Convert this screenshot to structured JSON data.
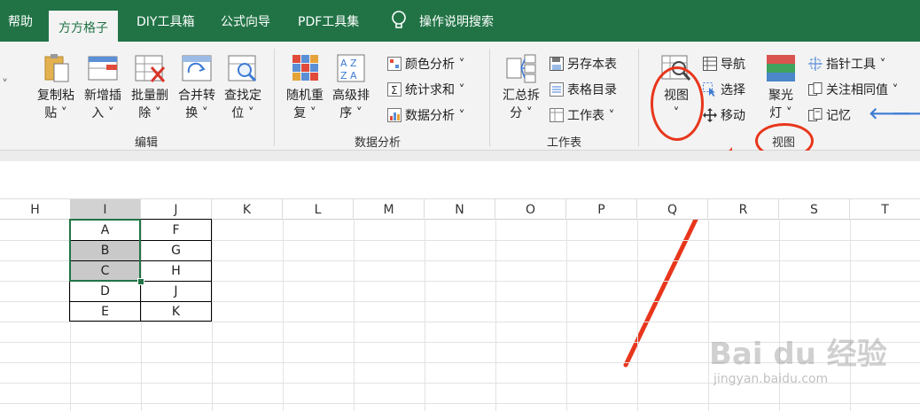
{
  "tabs": [
    "帮助",
    "方方格子",
    "DIY工具箱",
    "公式向导",
    "PDF工具集",
    "操作说明搜索"
  ],
  "active_tab": "方方格子",
  "groups": {
    "edit": {
      "label": "编辑",
      "buttons": [
        {
          "line1": "复制粘",
          "line2": "贴 ˅",
          "icon": "paste-icon"
        },
        {
          "line1": "新增插",
          "line2": "入 ˅",
          "icon": "insert-icon"
        },
        {
          "line1": "批量删",
          "line2": "除 ˅",
          "icon": "delete-icon"
        },
        {
          "line1": "合并转",
          "line2": "换 ˅",
          "icon": "merge-icon"
        },
        {
          "line1": "查找定",
          "line2": "位 ˅",
          "icon": "find-icon"
        }
      ]
    },
    "analysis": {
      "label": "数据分析",
      "buttons": [
        {
          "line1": "随机重",
          "line2": "复 ˅",
          "icon": "random-icon"
        },
        {
          "line1": "高级排",
          "line2": "序 ˅",
          "icon": "sort-icon"
        }
      ],
      "small": [
        "颜色分析 ˅",
        "统计求和 ˅",
        "数据分析 ˅"
      ]
    },
    "sheet": {
      "label": "工作表",
      "buttons": [
        {
          "line1": "汇总拆",
          "line2": "分 ˅",
          "icon": "split-icon"
        }
      ],
      "small": [
        "另存本表",
        "表格目录",
        "工作表 ˅"
      ]
    },
    "view": {
      "label": "视图",
      "view_button": {
        "line1": "视图",
        "line2": "˅"
      },
      "small": [
        "导航",
        "选择",
        "移动"
      ],
      "spotlight": {
        "line1": "聚光",
        "line2": "灯 ˅"
      },
      "right": [
        "指针工具 ˅",
        "关注相同值 ˅",
        "记忆"
      ]
    }
  },
  "columns": [
    "H",
    "I",
    "J",
    "K",
    "L",
    "M",
    "N",
    "O",
    "P",
    "Q",
    "R",
    "S",
    "T"
  ],
  "table": [
    [
      "A",
      "F"
    ],
    [
      "B",
      "G"
    ],
    [
      "C",
      "H"
    ],
    [
      "D",
      "J"
    ],
    [
      "E",
      "K"
    ]
  ],
  "watermark": {
    "brand": "Bai du 经验",
    "url": "jingyan.baidu.com"
  },
  "colors": {
    "ribbon_green": "#217346",
    "annotation_red": "#e8361c"
  }
}
